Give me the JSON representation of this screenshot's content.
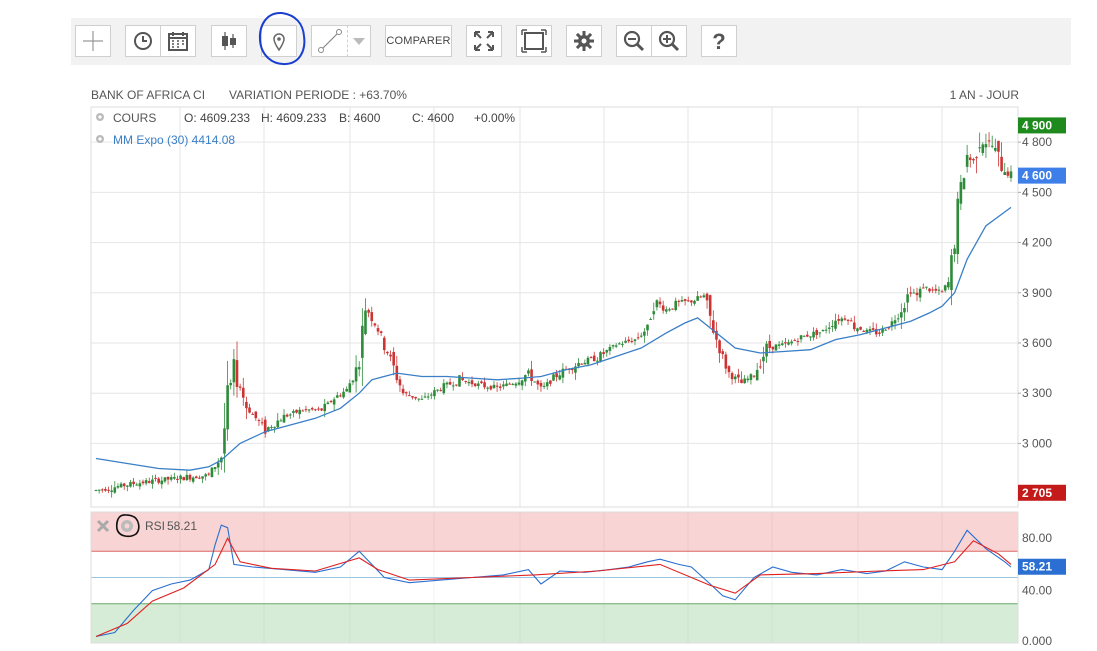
{
  "toolbar": {
    "buttons": [
      {
        "name": "crosshair-button",
        "icon": "crosshair-icon"
      },
      {
        "name": "history-button",
        "icon": "clock-icon"
      },
      {
        "name": "calendar-button",
        "icon": "calendar-icon"
      },
      {
        "name": "candlestick-button",
        "icon": "candlestick-icon"
      },
      {
        "name": "marker-button",
        "icon": "map-pin-icon"
      },
      {
        "name": "trendline-button",
        "icon": "line-tool-icon"
      },
      {
        "name": "trendline-dropdown",
        "icon": "caret-down-icon"
      },
      {
        "name": "fullscreen-button",
        "icon": "expand-icon"
      },
      {
        "name": "fit-button",
        "icon": "frame-icon"
      },
      {
        "name": "settings-button",
        "icon": "gear-icon"
      },
      {
        "name": "zoom-out-button",
        "icon": "zoom-out-icon"
      },
      {
        "name": "zoom-in-button",
        "icon": "zoom-in-icon"
      },
      {
        "name": "help-button",
        "icon": "question-icon"
      }
    ],
    "compare_label": "COMPARER"
  },
  "header": {
    "title": "BANK OF AFRICA CI",
    "variation": "VARIATION PERIODE : +63.70%",
    "period": "1 AN - JOUR"
  },
  "legend": {
    "cours_label": "COURS",
    "open": "O: 4609.233",
    "high": "H: 4609.233",
    "low": "B: 4600",
    "close": "C: 4600",
    "change": "+0.00%",
    "ma_label": "MM Expo (30) 4414.08"
  },
  "rsi": {
    "label": "RSI",
    "value": "58.21",
    "overbought": 70,
    "oversold": 30,
    "midline": 50
  },
  "colors": {
    "up": "#2e8b3a",
    "down": "#cc3333",
    "ma": "#3a7fc7",
    "rsi_line": "#2a6fd1",
    "rsi_signal": "#e02020",
    "annotation_circle": "#1a3fcf",
    "rsi_over_zone": "#f8d4d4",
    "rsi_under_zone": "#d7ecd7"
  },
  "chart_data": {
    "type": "candlestick",
    "price_axis_ticks": [
      "4 800",
      "4 500",
      "4 200",
      "3 900",
      "3 600",
      "3 300",
      "3 000"
    ],
    "price_axis_values": [
      4800,
      4500,
      4200,
      3900,
      3600,
      3300,
      3000
    ],
    "ylim": [
      2620,
      5010
    ],
    "price_labels": [
      {
        "text": "4 900",
        "value": 4900,
        "color": "#1e8a1e"
      },
      {
        "text": "4 600",
        "value": 4600,
        "color": "#3d7ee8"
      },
      {
        "text": "2 705",
        "value": 2705,
        "color": "#c41a1a"
      }
    ],
    "rsi_axis_ticks": [
      "80.00",
      "40.00",
      "0.000"
    ],
    "rsi_axis_values": [
      80,
      40,
      0
    ],
    "rsi_ylim": [
      0,
      100
    ],
    "rsi_last_label": "58.21",
    "price_path": [
      [
        0,
        2720
      ],
      [
        12,
        2760
      ],
      [
        20,
        2780
      ],
      [
        30,
        2800
      ],
      [
        36,
        2810
      ],
      [
        40,
        2920
      ],
      [
        42,
        3260
      ],
      [
        44,
        3450
      ],
      [
        48,
        3220
      ],
      [
        54,
        3080
      ],
      [
        60,
        3160
      ],
      [
        66,
        3200
      ],
      [
        72,
        3200
      ],
      [
        76,
        3270
      ],
      [
        80,
        3320
      ],
      [
        84,
        3480
      ],
      [
        86,
        3820
      ],
      [
        90,
        3680
      ],
      [
        94,
        3500
      ],
      [
        98,
        3300
      ],
      [
        104,
        3260
      ],
      [
        110,
        3330
      ],
      [
        116,
        3380
      ],
      [
        122,
        3350
      ],
      [
        128,
        3330
      ],
      [
        134,
        3370
      ],
      [
        138,
        3420
      ],
      [
        142,
        3320
      ],
      [
        148,
        3420
      ],
      [
        154,
        3480
      ],
      [
        160,
        3510
      ],
      [
        166,
        3590
      ],
      [
        172,
        3620
      ],
      [
        176,
        3690
      ],
      [
        178,
        3850
      ],
      [
        182,
        3800
      ],
      [
        186,
        3840
      ],
      [
        190,
        3850
      ],
      [
        194,
        3880
      ],
      [
        198,
        3620
      ],
      [
        202,
        3420
      ],
      [
        206,
        3360
      ],
      [
        210,
        3410
      ],
      [
        214,
        3570
      ],
      [
        220,
        3590
      ],
      [
        226,
        3640
      ],
      [
        232,
        3670
      ],
      [
        236,
        3740
      ],
      [
        240,
        3750
      ],
      [
        242,
        3700
      ],
      [
        246,
        3670
      ],
      [
        250,
        3660
      ],
      [
        254,
        3720
      ],
      [
        258,
        3840
      ],
      [
        260,
        3920
      ],
      [
        262,
        3880
      ],
      [
        264,
        3940
      ],
      [
        266,
        3920
      ],
      [
        270,
        3900
      ],
      [
        272,
        3960
      ],
      [
        274,
        4200
      ],
      [
        276,
        4520
      ],
      [
        278,
        4720
      ],
      [
        280,
        4680
      ],
      [
        282,
        4830
      ],
      [
        286,
        4780
      ],
      [
        288,
        4700
      ],
      [
        290,
        4640
      ],
      [
        292,
        4600
      ]
    ],
    "ma_path": [
      [
        0,
        2910
      ],
      [
        10,
        2880
      ],
      [
        20,
        2850
      ],
      [
        30,
        2840
      ],
      [
        36,
        2860
      ],
      [
        40,
        2900
      ],
      [
        46,
        3000
      ],
      [
        54,
        3070
      ],
      [
        62,
        3110
      ],
      [
        70,
        3150
      ],
      [
        78,
        3210
      ],
      [
        84,
        3300
      ],
      [
        88,
        3380
      ],
      [
        96,
        3420
      ],
      [
        104,
        3400
      ],
      [
        112,
        3400
      ],
      [
        120,
        3390
      ],
      [
        128,
        3380
      ],
      [
        136,
        3390
      ],
      [
        142,
        3400
      ],
      [
        150,
        3440
      ],
      [
        158,
        3470
      ],
      [
        166,
        3520
      ],
      [
        174,
        3570
      ],
      [
        182,
        3660
      ],
      [
        188,
        3720
      ],
      [
        192,
        3750
      ],
      [
        198,
        3660
      ],
      [
        204,
        3570
      ],
      [
        212,
        3540
      ],
      [
        220,
        3550
      ],
      [
        228,
        3560
      ],
      [
        236,
        3620
      ],
      [
        244,
        3650
      ],
      [
        252,
        3690
      ],
      [
        260,
        3730
      ],
      [
        266,
        3780
      ],
      [
        270,
        3820
      ],
      [
        274,
        3900
      ],
      [
        278,
        4100
      ],
      [
        284,
        4300
      ],
      [
        292,
        4410
      ]
    ],
    "rsi_path": [
      [
        0,
        5
      ],
      [
        6,
        8
      ],
      [
        12,
        25
      ],
      [
        18,
        40
      ],
      [
        24,
        45
      ],
      [
        30,
        48
      ],
      [
        36,
        56
      ],
      [
        38,
        75
      ],
      [
        40,
        90
      ],
      [
        42,
        88
      ],
      [
        44,
        60
      ],
      [
        50,
        58
      ],
      [
        60,
        56
      ],
      [
        70,
        54
      ],
      [
        78,
        58
      ],
      [
        84,
        70
      ],
      [
        88,
        60
      ],
      [
        92,
        50
      ],
      [
        100,
        46
      ],
      [
        110,
        48
      ],
      [
        120,
        50
      ],
      [
        130,
        52
      ],
      [
        138,
        56
      ],
      [
        142,
        45
      ],
      [
        148,
        55
      ],
      [
        156,
        54
      ],
      [
        164,
        56
      ],
      [
        170,
        58
      ],
      [
        176,
        62
      ],
      [
        180,
        64
      ],
      [
        186,
        60
      ],
      [
        190,
        58
      ],
      [
        196,
        45
      ],
      [
        200,
        36
      ],
      [
        204,
        33
      ],
      [
        210,
        50
      ],
      [
        216,
        58
      ],
      [
        222,
        54
      ],
      [
        230,
        52
      ],
      [
        238,
        56
      ],
      [
        246,
        53
      ],
      [
        252,
        55
      ],
      [
        258,
        62
      ],
      [
        264,
        58
      ],
      [
        270,
        56
      ],
      [
        274,
        70
      ],
      [
        278,
        86
      ],
      [
        284,
        72
      ],
      [
        290,
        62
      ],
      [
        292,
        58
      ]
    ],
    "rsi_signal_path": [
      [
        0,
        5
      ],
      [
        10,
        15
      ],
      [
        18,
        32
      ],
      [
        28,
        42
      ],
      [
        38,
        60
      ],
      [
        42,
        80
      ],
      [
        46,
        62
      ],
      [
        56,
        57
      ],
      [
        70,
        55
      ],
      [
        84,
        65
      ],
      [
        90,
        56
      ],
      [
        100,
        48
      ],
      [
        120,
        50
      ],
      [
        140,
        52
      ],
      [
        160,
        55
      ],
      [
        180,
        60
      ],
      [
        196,
        44
      ],
      [
        204,
        38
      ],
      [
        212,
        52
      ],
      [
        230,
        53
      ],
      [
        250,
        55
      ],
      [
        264,
        56
      ],
      [
        274,
        62
      ],
      [
        280,
        78
      ],
      [
        288,
        68
      ],
      [
        292,
        60
      ]
    ]
  }
}
